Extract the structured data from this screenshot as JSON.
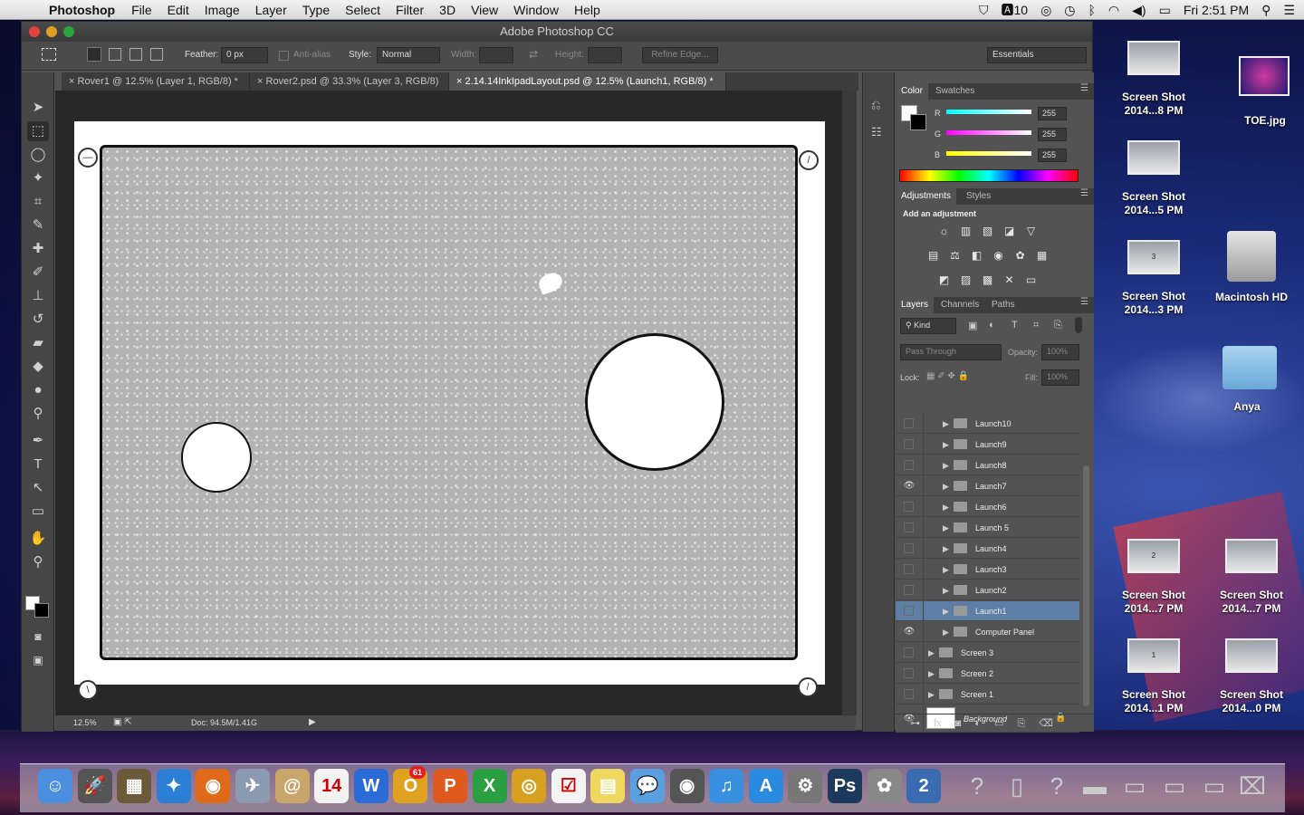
{
  "menubar": {
    "app": "Photoshop",
    "items": [
      "File",
      "Edit",
      "Image",
      "Layer",
      "Type",
      "Select",
      "Filter",
      "3D",
      "View",
      "Window",
      "Help"
    ],
    "status": {
      "adobe_count": "10",
      "clock": "Fri 2:51 PM"
    }
  },
  "window": {
    "title": "Adobe Photoshop CC"
  },
  "options": {
    "feather_label": "Feather:",
    "feather_value": "0 px",
    "antialias": "Anti-alias",
    "style_label": "Style:",
    "style_value": "Normal",
    "width_label": "Width:",
    "height_label": "Height:",
    "refine": "Refine Edge...",
    "workspace": "Essentials"
  },
  "tabs": [
    "Rover1 @ 12.5% (Layer 1, RGB/8) *",
    "Rover2.psd @ 33.3% (Layer 3, RGB/8)",
    "2.14.14InkIpadLayout.psd @ 12.5% (Launch1, RGB/8) *"
  ],
  "tab_close": "×",
  "status": {
    "zoom": "12.5%",
    "doc": "Doc: 94.5M/1.41G"
  },
  "color_panel": {
    "tabs": [
      "Color",
      "Swatches"
    ],
    "labels": [
      "R",
      "G",
      "B"
    ],
    "values": [
      "255",
      "255",
      "255"
    ]
  },
  "adjust_panel": {
    "tabs": [
      "Adjustments",
      "Styles"
    ],
    "heading": "Add an adjustment"
  },
  "layers_panel": {
    "tabs": [
      "Layers",
      "Channels",
      "Paths"
    ],
    "kind": "Kind",
    "blend": "Pass Through",
    "opacity_label": "Opacity:",
    "opacity_value": "100%",
    "lock_label": "Lock:",
    "fill_label": "Fill:",
    "fill_value": "100%",
    "layers": [
      {
        "name": "Launch10",
        "visible": false,
        "indent": 1,
        "selected": false
      },
      {
        "name": "Launch9",
        "visible": false,
        "indent": 1,
        "selected": false
      },
      {
        "name": "Launch8",
        "visible": false,
        "indent": 1,
        "selected": false
      },
      {
        "name": "Launch7",
        "visible": true,
        "indent": 1,
        "selected": false
      },
      {
        "name": "Launch6",
        "visible": false,
        "indent": 1,
        "selected": false
      },
      {
        "name": "Launch 5",
        "visible": false,
        "indent": 1,
        "selected": false
      },
      {
        "name": "Launch4",
        "visible": false,
        "indent": 1,
        "selected": false
      },
      {
        "name": "Launch3",
        "visible": false,
        "indent": 1,
        "selected": false
      },
      {
        "name": "Launch2",
        "visible": false,
        "indent": 1,
        "selected": false
      },
      {
        "name": "Launch1",
        "visible": false,
        "indent": 1,
        "selected": true
      },
      {
        "name": "Computer Panel",
        "visible": true,
        "indent": 1,
        "selected": false
      },
      {
        "name": "Screen 3",
        "visible": false,
        "indent": 0,
        "selected": false
      },
      {
        "name": "Screen 2",
        "visible": false,
        "indent": 0,
        "selected": false
      },
      {
        "name": "Screen 1",
        "visible": false,
        "indent": 0,
        "selected": false
      }
    ],
    "background": "Background"
  },
  "desktop": {
    "items": [
      {
        "label": "Screen Shot 2014...8 PM",
        "thumb": ""
      },
      {
        "label": "TOE.jpg",
        "thumb": ""
      },
      {
        "label": "Screen Shot 2014...5 PM",
        "thumb": ""
      },
      {
        "label": "Screen Shot 2014...3 PM",
        "thumb": "3"
      },
      {
        "label": "Macintosh HD",
        "thumb": ""
      },
      {
        "label": "Anya",
        "thumb": ""
      },
      {
        "label": "Screen Shot 2014...7 PM",
        "thumb": "2"
      },
      {
        "label": "Screen Shot 2014...7 PM",
        "thumb": ""
      },
      {
        "label": "Screen Shot 2014...1 PM",
        "thumb": "1"
      },
      {
        "label": "Screen Shot 2014...0 PM",
        "thumb": ""
      }
    ]
  },
  "dock": {
    "items": [
      {
        "name": "finder",
        "glyph": "☺",
        "color": "#4a8fe0"
      },
      {
        "name": "launchpad",
        "glyph": "🚀",
        "color": "#555"
      },
      {
        "name": "preview",
        "glyph": "▦",
        "color": "#6a5a3a"
      },
      {
        "name": "safari",
        "glyph": "✦",
        "color": "#2b7fd4"
      },
      {
        "name": "firefox",
        "glyph": "◉",
        "color": "#e06a1a"
      },
      {
        "name": "mail-bird",
        "glyph": "✈",
        "color": "#8a9ab0"
      },
      {
        "name": "contacts",
        "glyph": "@",
        "color": "#c8a56a"
      },
      {
        "name": "calendar",
        "glyph": "14",
        "color": "#f2f2f2"
      },
      {
        "name": "word",
        "glyph": "W",
        "color": "#2a6bd8"
      },
      {
        "name": "outlook",
        "glyph": "O",
        "color": "#e0a020"
      },
      {
        "name": "powerpoint",
        "glyph": "P",
        "color": "#e05a20"
      },
      {
        "name": "excel",
        "glyph": "X",
        "color": "#2aa040"
      },
      {
        "name": "chrome",
        "glyph": "◎",
        "color": "#d8a020"
      },
      {
        "name": "reminders",
        "glyph": "☑",
        "color": "#f4f4f4"
      },
      {
        "name": "stickies",
        "glyph": "▤",
        "color": "#f0d860"
      },
      {
        "name": "messages",
        "glyph": "💬",
        "color": "#5aa0e0"
      },
      {
        "name": "facetime",
        "glyph": "◉",
        "color": "#555"
      },
      {
        "name": "itunes",
        "glyph": "♫",
        "color": "#3a90e0"
      },
      {
        "name": "appstore",
        "glyph": "A",
        "color": "#2a8ae0"
      },
      {
        "name": "systemprefs",
        "glyph": "⚙",
        "color": "#777"
      },
      {
        "name": "photoshop",
        "glyph": "Ps",
        "color": "#1d3a5e"
      },
      {
        "name": "iphoto",
        "glyph": "✿",
        "color": "#888"
      },
      {
        "name": "timemachine",
        "glyph": "2",
        "color": "#3a6ab0"
      }
    ],
    "badge": "61"
  }
}
